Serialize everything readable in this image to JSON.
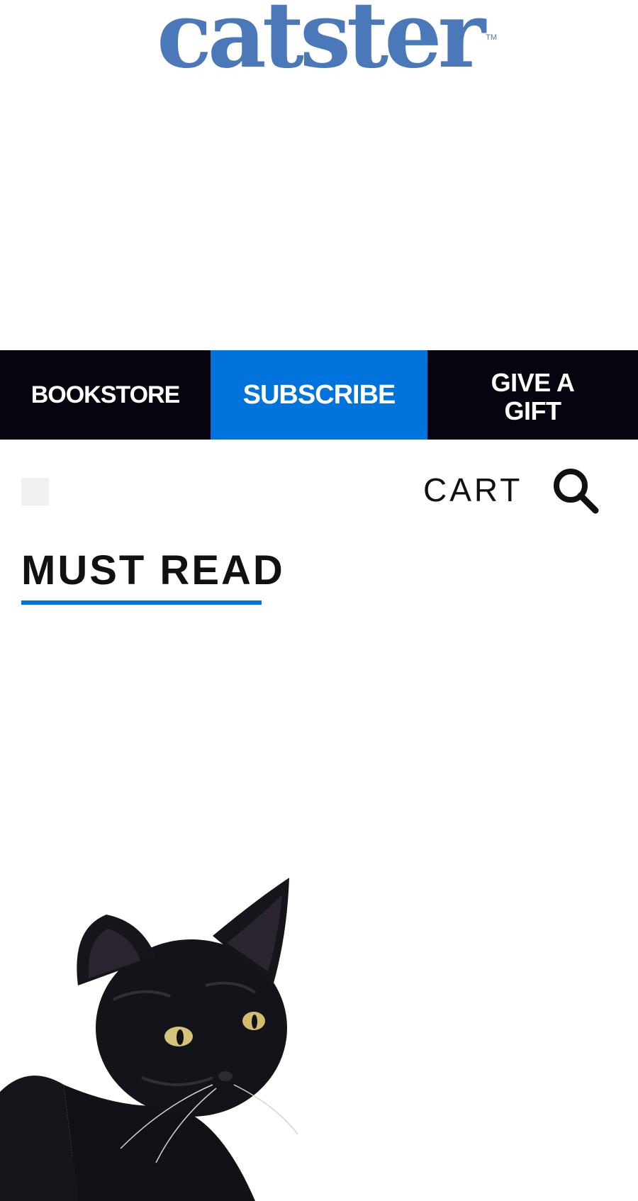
{
  "header": {
    "logo_text": "catster",
    "logo_tm": "TM",
    "logo_color": "#4a78b8"
  },
  "promo_bar": {
    "bookstore_label": "BOOKSTORE",
    "subscribe_label": "SUBSCRIBE",
    "gift_label": "GIVE A GIFT",
    "bar_color": "#07030f",
    "subscribe_color": "#0073dc"
  },
  "utility_bar": {
    "cart_label": "CART",
    "menu_icon": "menu-icon",
    "search_icon": "search-icon"
  },
  "main": {
    "section_title": "MUST READ",
    "accent_color": "#0073dc",
    "feature_image_icon": "black-cat-photo"
  }
}
